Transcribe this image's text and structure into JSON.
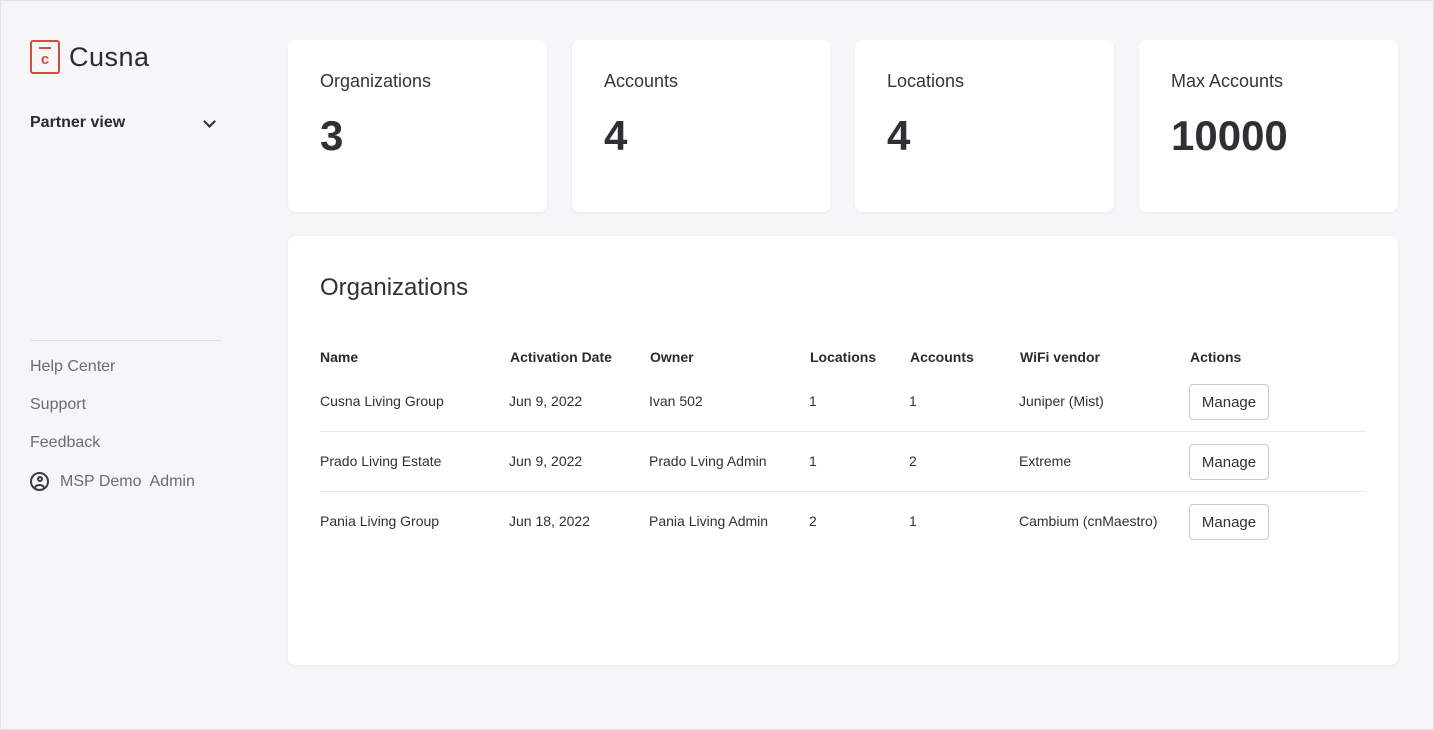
{
  "brand": {
    "name": "Cusna",
    "logo_letter": "c",
    "accent": "#d94a3d"
  },
  "sidebar": {
    "view_selector": "Partner view",
    "links": [
      "Help Center",
      "Support",
      "Feedback"
    ],
    "user": "MSP Demo  Admin"
  },
  "stats": [
    {
      "label": "Organizations",
      "value": "3"
    },
    {
      "label": "Accounts",
      "value": "4"
    },
    {
      "label": "Locations",
      "value": "4"
    },
    {
      "label": "Max Accounts",
      "value": "10000"
    }
  ],
  "organizations": {
    "title": "Organizations",
    "columns": [
      "Name",
      "Activation Date",
      "Owner",
      "Locations",
      "Accounts",
      "WiFi vendor",
      "Actions"
    ],
    "rows": [
      {
        "name": "Cusna Living Group",
        "activation_date": "Jun 9, 2022",
        "owner": "Ivan 502",
        "locations": "1",
        "accounts": "1",
        "wifi_vendor": "Juniper (Mist)",
        "action": "Manage"
      },
      {
        "name": "Prado Living Estate",
        "activation_date": "Jun 9, 2022",
        "owner": "Prado Lving Admin",
        "locations": "1",
        "accounts": "2",
        "wifi_vendor": "Extreme",
        "action": "Manage"
      },
      {
        "name": "Pania Living Group",
        "activation_date": "Jun 18, 2022",
        "owner": "Pania Living Admin",
        "locations": "2",
        "accounts": "1",
        "wifi_vendor": "Cambium (cnMaestro)",
        "action": "Manage"
      }
    ]
  }
}
